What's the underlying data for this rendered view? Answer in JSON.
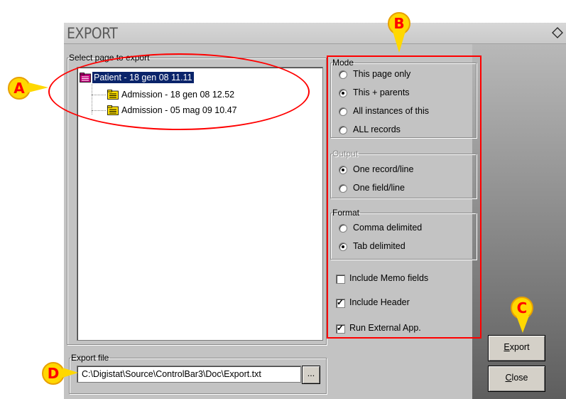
{
  "window": {
    "title": "EXPORT",
    "tree_group_label": "Select page to export",
    "tree": {
      "root": "Patient - 18 gen 08 11.11",
      "children": [
        "Admission - 18 gen 08 12.52",
        "Admission - 05 mag 09 10.47"
      ]
    },
    "mode": {
      "label": "Mode",
      "options": [
        "This page only",
        "This + parents",
        "All instances of this",
        "ALL records"
      ],
      "selected": "This + parents"
    },
    "output": {
      "label": "Output",
      "options": [
        "One record/line",
        "One field/line"
      ],
      "selected": "One record/line"
    },
    "format": {
      "label": "Format",
      "options": [
        "Comma delimited",
        "Tab delimited"
      ],
      "selected": "Tab delimited"
    },
    "checkboxes": [
      {
        "label": "Include Memo fields",
        "checked": false
      },
      {
        "label": "Include Header",
        "checked": true
      },
      {
        "label": "Run External App.",
        "checked": true
      }
    ],
    "export_file": {
      "label": "Export file",
      "value": "C:\\Digistat\\Source\\ControlBar3\\Doc\\Export.txt",
      "browse_label": "..."
    },
    "buttons": {
      "export": "Export",
      "close": "Close"
    }
  },
  "callouts": {
    "a": "A",
    "b": "B",
    "c": "C",
    "d": "D"
  },
  "colors": {
    "callout_fill": "#ffd800",
    "callout_text": "#ff0000",
    "highlight": "#ff0000",
    "tree_selection": "#0a246a"
  }
}
